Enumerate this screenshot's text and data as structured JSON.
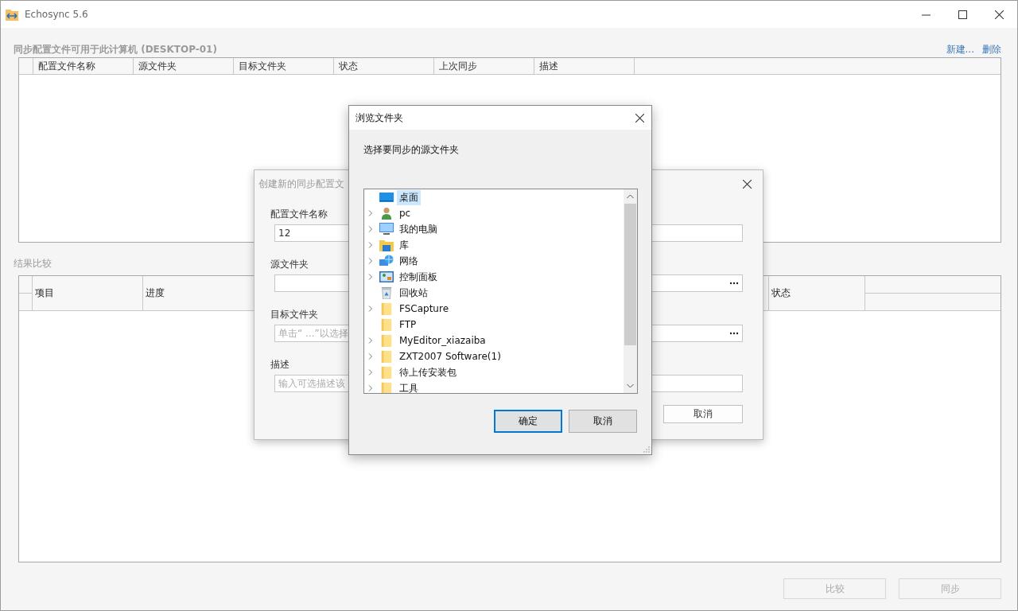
{
  "window": {
    "title": "Echosync 5.6"
  },
  "profiles": {
    "title": "同步配置文件可用于此计算机 (DESKTOP-01)",
    "actions": [
      "新建...",
      "删除"
    ],
    "columns": [
      "配置文件名称",
      "源文件夹",
      "目标文件夹",
      "状态",
      "上次同步",
      "描述"
    ]
  },
  "results": {
    "title": "结果比较",
    "columns": [
      "项目",
      "进度",
      "状态"
    ]
  },
  "buttons": [
    {
      "label": "比较",
      "disabled": true
    },
    {
      "label": "同步",
      "disabled": true
    }
  ],
  "create_dialog": {
    "title": "创建新的同步配置文",
    "fields": [
      {
        "label": "配置文件名称",
        "value": "12",
        "kind": "text"
      },
      {
        "label": "源文件夹",
        "kind": "browse"
      },
      {
        "label": "目标文件夹",
        "placeholder": "单击“ ...”以选择",
        "kind": "browse"
      },
      {
        "label": "描述",
        "placeholder": "输入可选描述该",
        "kind": "text"
      }
    ],
    "buttons": [
      "取消"
    ]
  },
  "browse_dialog": {
    "title": "浏览文件夹",
    "prompt": "选择要同步的源文件夹",
    "tree": [
      {
        "label": "桌面",
        "kind": "desktop",
        "expandable": false,
        "selected": true
      },
      {
        "label": "pc",
        "kind": "user",
        "expandable": true,
        "selected": false
      },
      {
        "label": "我的电脑",
        "kind": "computer",
        "expandable": true,
        "selected": false
      },
      {
        "label": "库",
        "kind": "library",
        "expandable": true,
        "selected": false
      },
      {
        "label": "网络",
        "kind": "network",
        "expandable": true,
        "selected": false
      },
      {
        "label": "控制面板",
        "kind": "control-panel",
        "expandable": true,
        "selected": false
      },
      {
        "label": "回收站",
        "kind": "recycle",
        "expandable": false,
        "selected": false
      },
      {
        "label": "FSCapture",
        "kind": "folder",
        "expandable": true,
        "selected": false
      },
      {
        "label": "FTP",
        "kind": "folder",
        "expandable": false,
        "selected": false
      },
      {
        "label": "MyEditor_xiazaiba",
        "kind": "folder",
        "expandable": true,
        "selected": false
      },
      {
        "label": "ZXT2007 Software(1)",
        "kind": "folder",
        "expandable": true,
        "selected": false
      },
      {
        "label": "待上传安装包",
        "kind": "folder",
        "expandable": true,
        "selected": false
      },
      {
        "label": "工具",
        "kind": "folder",
        "expandable": true,
        "selected": false
      }
    ],
    "buttons": [
      {
        "label": "确定",
        "default": true
      },
      {
        "label": "取消",
        "default": false
      }
    ]
  }
}
